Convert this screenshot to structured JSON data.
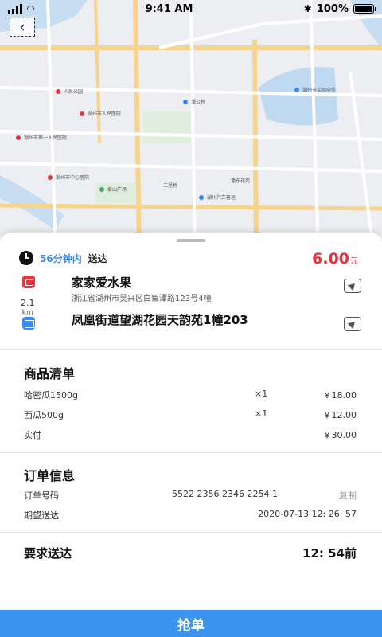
{
  "status_bar": {
    "time": "9:41 AM",
    "battery": "100%"
  },
  "order": {
    "eta": "56分钟内",
    "deliver_label": "送达",
    "price": "6.00",
    "price_unit": "元",
    "shop": {
      "name": "家家爱水果",
      "address": "浙江省湖州市吴兴区白鱼潭路123号4幢"
    },
    "distance": {
      "value": "2.1",
      "unit": "km"
    },
    "destination": {
      "name": "凤凰街道望湖花园天韵苑1幢203"
    }
  },
  "goods": {
    "title": "商品清单",
    "items": [
      {
        "name": "哈密瓜1500g",
        "qty": "×1",
        "price": "￥18.00"
      },
      {
        "name": "西瓜500g",
        "qty": "×1",
        "price": "￥12.00"
      }
    ],
    "paid_label": "实付",
    "paid_value": "￥30.00"
  },
  "order_info": {
    "title": "订单信息",
    "number_label": "订单号码",
    "number_value": "5522 2356 2346 2254 1",
    "copy_label": "复制",
    "expected_label": "期望送达",
    "expected_value": "2020-07-13 12: 26: 57"
  },
  "required": {
    "label": "要求送达",
    "value": "12: 54前"
  },
  "action": {
    "grab_label": "抢单"
  },
  "map_labels": [
    "人民公园",
    "湖州市人民医院",
    "潘公桥",
    "湖州市第一人民医院",
    "湖州市中心医院",
    "爱山广场",
    "湖州汽车客运",
    "二里桥",
    "湖州市实验中学",
    "潘东花苑"
  ],
  "colors": {
    "accent": "#3b95f0",
    "price": "#e8353d",
    "eta": "#3b8cf2"
  }
}
